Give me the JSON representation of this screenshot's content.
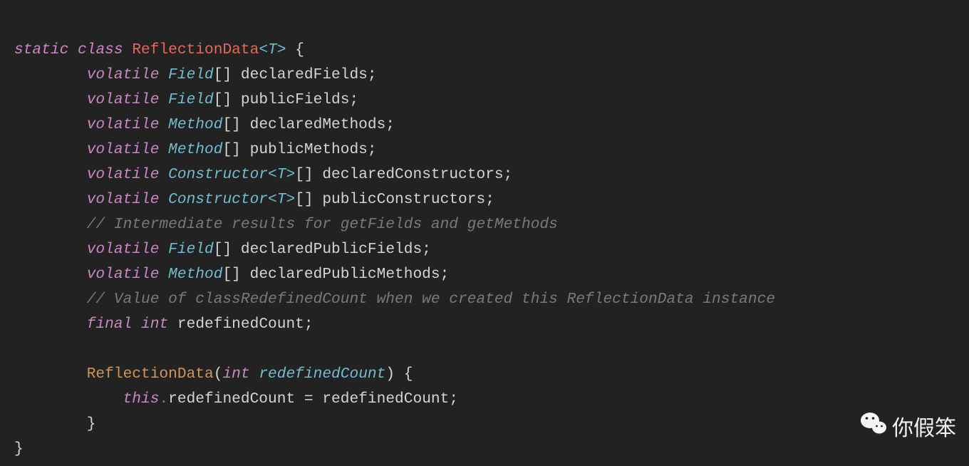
{
  "code": {
    "l1": {
      "k_static": "static",
      "k_class": "class",
      "classname": "ReflectionData",
      "generic": "<T>",
      "brace": " {"
    },
    "l2": {
      "k_vol": "volatile",
      "type": "Field",
      "arr": "[]",
      "name": "declaredFields",
      "semi": ";"
    },
    "l3": {
      "k_vol": "volatile",
      "type": "Field",
      "arr": "[]",
      "name": "publicFields",
      "semi": ";"
    },
    "l4": {
      "k_vol": "volatile",
      "type": "Method",
      "arr": "[]",
      "name": "declaredMethods",
      "semi": ";"
    },
    "l5": {
      "k_vol": "volatile",
      "type": "Method",
      "arr": "[]",
      "name": "publicMethods",
      "semi": ";"
    },
    "l6": {
      "k_vol": "volatile",
      "type": "Constructor",
      "gen": "<T>",
      "arr": "[]",
      "name": "declaredConstructors",
      "semi": ";"
    },
    "l7": {
      "k_vol": "volatile",
      "type": "Constructor",
      "gen": "<T>",
      "arr": "[]",
      "name": "publicConstructors",
      "semi": ";"
    },
    "l8": {
      "comment": "// Intermediate results for getFields and getMethods"
    },
    "l9": {
      "k_vol": "volatile",
      "type": "Field",
      "arr": "[]",
      "name": "declaredPublicFields",
      "semi": ";"
    },
    "l10": {
      "k_vol": "volatile",
      "type": "Method",
      "arr": "[]",
      "name": "declaredPublicMethods",
      "semi": ";"
    },
    "l11": {
      "comment": "// Value of classRedefinedCount when we created this ReflectionData instance"
    },
    "l12": {
      "k_final": "final",
      "k_int": "int",
      "name": "redefinedCount",
      "semi": ";"
    },
    "l13": {
      "blank": ""
    },
    "l14": {
      "ctor": "ReflectionData",
      "lp": "(",
      "k_int": "int",
      "param": "redefinedCount",
      "rp": ")",
      "brace": " {"
    },
    "l15": {
      "k_this": "this",
      "dot": ".",
      "field": "redefinedCount",
      "eq": " = ",
      "rhs": "redefinedCount",
      "semi": ";"
    },
    "l16": {
      "brace": "}"
    },
    "l17": {
      "brace": "}"
    }
  },
  "watermark": {
    "text": "你假笨"
  }
}
